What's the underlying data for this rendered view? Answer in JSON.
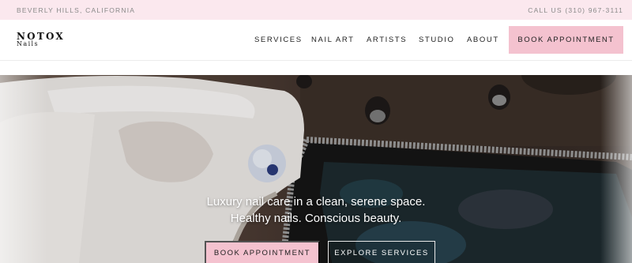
{
  "topbar": {
    "location": "BEVERLY HILLS, CALIFORNIA",
    "phone": "CALL US (310) 967-3111"
  },
  "brand": {
    "name": "NOTOX",
    "sub": "Nails"
  },
  "nav": {
    "items": [
      "SERVICES",
      "NAIL ART",
      "ARTISTS",
      "STUDIO",
      "ABOUT"
    ],
    "book_label": "BOOK APPOINTMENT"
  },
  "hero": {
    "line1": "Luxury nail care in a clean, serene space.",
    "line2": "Healthy nails. Conscious beauty.",
    "primary_cta": "BOOK APPOINTMENT",
    "secondary_cta": "EXPLORE SERVICES"
  },
  "colors": {
    "accent_pink": "#f4c2cf",
    "topbar_bg": "#fbe8ee"
  }
}
